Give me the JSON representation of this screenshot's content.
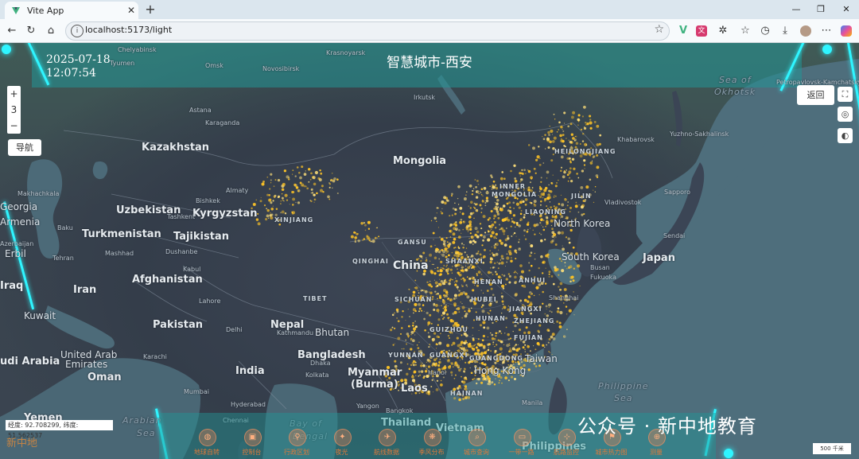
{
  "browser": {
    "tab_title": "Vite App",
    "url": "localhost:5173/light"
  },
  "header": {
    "title": "智慧城市-西安",
    "date": "2025-07-18",
    "time": "12:07:54"
  },
  "controls": {
    "zoom_in": "+",
    "zoom_level": "3",
    "zoom_out": "−",
    "nav_label": "导航",
    "back_label": "返回"
  },
  "countries": [
    {
      "name": "Kazakhstan"
    },
    {
      "name": "Mongolia"
    },
    {
      "name": "Uzbekistan"
    },
    {
      "name": "Kyrgyzstan"
    },
    {
      "name": "Turkmenistan"
    },
    {
      "name": "Tajikistan"
    },
    {
      "name": "Afghanistan"
    },
    {
      "name": "China"
    },
    {
      "name": "Iran"
    },
    {
      "name": "Pakistan"
    },
    {
      "name": "Nepal"
    },
    {
      "name": "Bhutan"
    },
    {
      "name": "India"
    },
    {
      "name": "Bangladesh"
    },
    {
      "name": "Myanmar"
    },
    {
      "name": "(Burma)"
    },
    {
      "name": "Laos"
    },
    {
      "name": "Thailand"
    },
    {
      "name": "Vietnam"
    },
    {
      "name": "Philippines"
    },
    {
      "name": "Japan"
    },
    {
      "name": "North Korea"
    },
    {
      "name": "South Korea"
    },
    {
      "name": "Taiwan"
    },
    {
      "name": "Kuwait"
    },
    {
      "name": "Oman"
    },
    {
      "name": "United Arab"
    },
    {
      "name": "Emirates"
    },
    {
      "name": "Yemen"
    },
    {
      "name": "Georgia"
    },
    {
      "name": "Armenia"
    },
    {
      "name": "Iraq"
    },
    {
      "name": "udi Arabia"
    },
    {
      "name": "Azerbaijan"
    }
  ],
  "regions": [
    "HEILONGJIANG",
    "INNER",
    "MONGOLIA",
    "JILIN",
    "LIAONING",
    "XINJIANG",
    "GANSU",
    "QINGHAI",
    "SHAANXI",
    "HENAN",
    "HUBEI",
    "ANHUI",
    "SICHUAN",
    "HUNAN",
    "JIANGXI",
    "ZHEJIANG",
    "FUJIAN",
    "GUANGDONG",
    "GUANGXI",
    "YUNNAN",
    "GUIZHOU",
    "TIBET",
    "HAINAN",
    "GUIZHOU"
  ],
  "cities": [
    "Chelyabinsk",
    "Omsk",
    "Tyumen",
    "Novosibirsk",
    "Krasnoyarsk",
    "Irkutsk",
    "Astana",
    "Karaganda",
    "Almaty",
    "Bishkek",
    "Tashkent",
    "Dushanbe",
    "Mashhad",
    "Tehran",
    "Kabul",
    "Baku",
    "Makhachkala",
    "Erbil",
    "Lahore",
    "Karachi",
    "Delhi",
    "Dhaka",
    "Kolkata",
    "Mumbai",
    "Hyderabad",
    "Hanoi",
    "Hong Kong",
    "Bangkok",
    "Yangon",
    "Manila",
    "Busan",
    "Sapporo",
    "Sendai",
    "Fukuoka",
    "Khabarovsk",
    "Vladivostok",
    "Shanghai",
    "Yuzhno-Sakhalinsk",
    "Petropavlovsk-Kamchatsky",
    "Chennai",
    "Kathmandu"
  ],
  "seas": [
    "Sea of",
    "Okhotsk",
    "Philippine",
    "Sea",
    "Arabian",
    "Sea",
    "Bay of",
    "Bengal"
  ],
  "bottom_menu": [
    {
      "label": "地球自转",
      "icon": "globe-icon"
    },
    {
      "label": "控制台",
      "icon": "console-icon"
    },
    {
      "label": "行政区划",
      "icon": "region-icon"
    },
    {
      "label": "夜光",
      "icon": "light-icon"
    },
    {
      "label": "航线数据",
      "icon": "route-icon"
    },
    {
      "label": "季风分布",
      "icon": "wind-icon"
    },
    {
      "label": "城市查询",
      "icon": "search-icon"
    },
    {
      "label": "一带一路",
      "icon": "belt-road-icon"
    },
    {
      "label": "航路监控",
      "icon": "monitor-icon"
    },
    {
      "label": "城市热力图",
      "icon": "heatmap-icon"
    },
    {
      "label": "测量",
      "icon": "measure-icon"
    }
  ],
  "status": {
    "coords": "经度: 92.708299, 纬度: 51.562537",
    "scale": "500 千米",
    "logo": "新中地",
    "watermark": "公众号 · 新中地教育"
  },
  "colors": {
    "banner": "#229696",
    "cyan_accent": "#2ff5ff",
    "light_glow": "#ffc425",
    "menu_label": "#e07a3a"
  }
}
